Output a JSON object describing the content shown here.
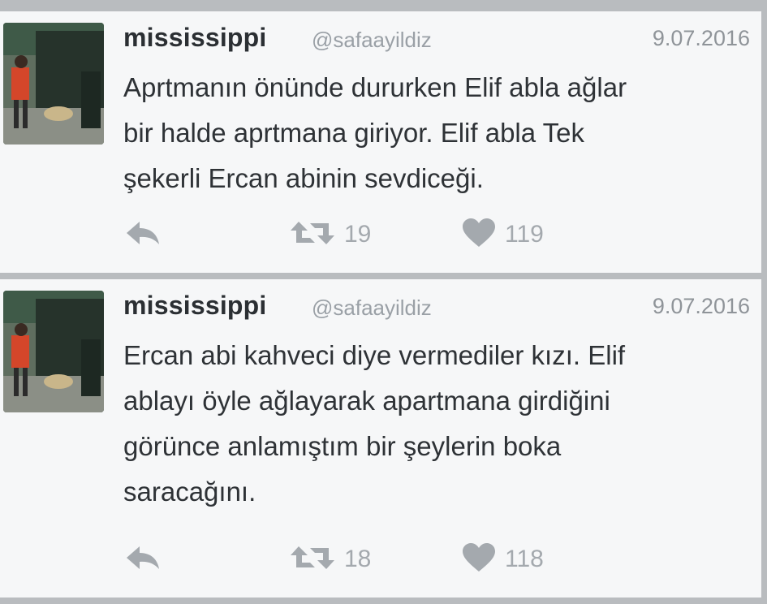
{
  "tweets": [
    {
      "display_name": "mississippi",
      "handle": "@safaayildiz",
      "date": "9.07.2016",
      "text_lines": [
        "Aprtmanın önünde dururken Elif abla ağlar",
        "bir halde aprtmana giriyor. Elif abla Tek",
        "şekerli Ercan abinin sevdiceği."
      ],
      "retweets": "19",
      "likes": "119"
    },
    {
      "display_name": "mississippi",
      "handle": "@safaayildiz",
      "date": "9.07.2016",
      "text_lines": [
        "Ercan abi kahveci diye vermediler kızı. Elif",
        "ablayı öyle ağlayarak apartmana girdiğini",
        "görünce anlamıştım bir şeylerin boka",
        "saracağını."
      ],
      "retweets": "18",
      "likes": "118"
    }
  ],
  "icons": {
    "reply": "reply-icon",
    "retweet": "retweet-icon",
    "like": "heart-icon"
  },
  "colors": {
    "card_background": "#f6f7f8",
    "page_background": "#b9bcbf",
    "name_text": "#2b2f33",
    "meta_text": "#9aa0a6",
    "icon_gray": "#a4a9ae"
  }
}
